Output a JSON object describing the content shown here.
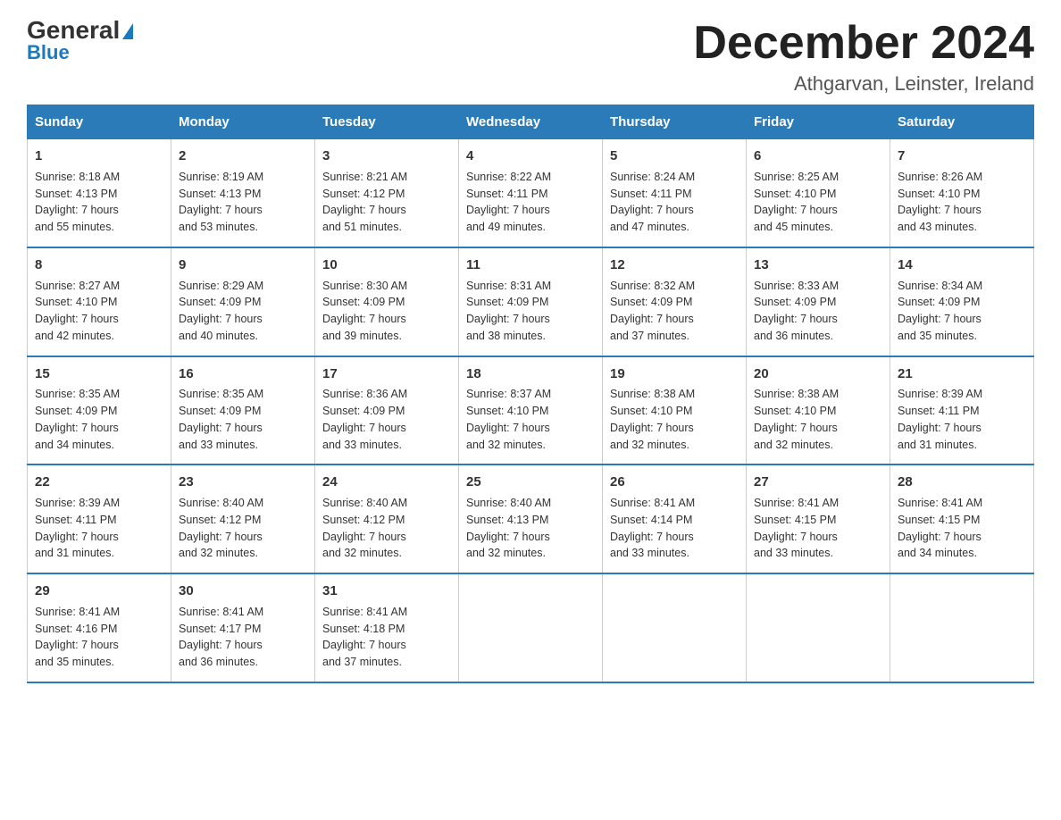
{
  "logo": {
    "general": "General",
    "blue": "Blue",
    "triangle": "▶"
  },
  "header": {
    "month_year": "December 2024",
    "location": "Athgarvan, Leinster, Ireland"
  },
  "columns": [
    "Sunday",
    "Monday",
    "Tuesday",
    "Wednesday",
    "Thursday",
    "Friday",
    "Saturday"
  ],
  "weeks": [
    [
      {
        "day": "1",
        "sunrise": "8:18 AM",
        "sunset": "4:13 PM",
        "daylight": "7 hours and 55 minutes."
      },
      {
        "day": "2",
        "sunrise": "8:19 AM",
        "sunset": "4:13 PM",
        "daylight": "7 hours and 53 minutes."
      },
      {
        "day": "3",
        "sunrise": "8:21 AM",
        "sunset": "4:12 PM",
        "daylight": "7 hours and 51 minutes."
      },
      {
        "day": "4",
        "sunrise": "8:22 AM",
        "sunset": "4:11 PM",
        "daylight": "7 hours and 49 minutes."
      },
      {
        "day": "5",
        "sunrise": "8:24 AM",
        "sunset": "4:11 PM",
        "daylight": "7 hours and 47 minutes."
      },
      {
        "day": "6",
        "sunrise": "8:25 AM",
        "sunset": "4:10 PM",
        "daylight": "7 hours and 45 minutes."
      },
      {
        "day": "7",
        "sunrise": "8:26 AM",
        "sunset": "4:10 PM",
        "daylight": "7 hours and 43 minutes."
      }
    ],
    [
      {
        "day": "8",
        "sunrise": "8:27 AM",
        "sunset": "4:10 PM",
        "daylight": "7 hours and 42 minutes."
      },
      {
        "day": "9",
        "sunrise": "8:29 AM",
        "sunset": "4:09 PM",
        "daylight": "7 hours and 40 minutes."
      },
      {
        "day": "10",
        "sunrise": "8:30 AM",
        "sunset": "4:09 PM",
        "daylight": "7 hours and 39 minutes."
      },
      {
        "day": "11",
        "sunrise": "8:31 AM",
        "sunset": "4:09 PM",
        "daylight": "7 hours and 38 minutes."
      },
      {
        "day": "12",
        "sunrise": "8:32 AM",
        "sunset": "4:09 PM",
        "daylight": "7 hours and 37 minutes."
      },
      {
        "day": "13",
        "sunrise": "8:33 AM",
        "sunset": "4:09 PM",
        "daylight": "7 hours and 36 minutes."
      },
      {
        "day": "14",
        "sunrise": "8:34 AM",
        "sunset": "4:09 PM",
        "daylight": "7 hours and 35 minutes."
      }
    ],
    [
      {
        "day": "15",
        "sunrise": "8:35 AM",
        "sunset": "4:09 PM",
        "daylight": "7 hours and 34 minutes."
      },
      {
        "day": "16",
        "sunrise": "8:35 AM",
        "sunset": "4:09 PM",
        "daylight": "7 hours and 33 minutes."
      },
      {
        "day": "17",
        "sunrise": "8:36 AM",
        "sunset": "4:09 PM",
        "daylight": "7 hours and 33 minutes."
      },
      {
        "day": "18",
        "sunrise": "8:37 AM",
        "sunset": "4:10 PM",
        "daylight": "7 hours and 32 minutes."
      },
      {
        "day": "19",
        "sunrise": "8:38 AM",
        "sunset": "4:10 PM",
        "daylight": "7 hours and 32 minutes."
      },
      {
        "day": "20",
        "sunrise": "8:38 AM",
        "sunset": "4:10 PM",
        "daylight": "7 hours and 32 minutes."
      },
      {
        "day": "21",
        "sunrise": "8:39 AM",
        "sunset": "4:11 PM",
        "daylight": "7 hours and 31 minutes."
      }
    ],
    [
      {
        "day": "22",
        "sunrise": "8:39 AM",
        "sunset": "4:11 PM",
        "daylight": "7 hours and 31 minutes."
      },
      {
        "day": "23",
        "sunrise": "8:40 AM",
        "sunset": "4:12 PM",
        "daylight": "7 hours and 32 minutes."
      },
      {
        "day": "24",
        "sunrise": "8:40 AM",
        "sunset": "4:12 PM",
        "daylight": "7 hours and 32 minutes."
      },
      {
        "day": "25",
        "sunrise": "8:40 AM",
        "sunset": "4:13 PM",
        "daylight": "7 hours and 32 minutes."
      },
      {
        "day": "26",
        "sunrise": "8:41 AM",
        "sunset": "4:14 PM",
        "daylight": "7 hours and 33 minutes."
      },
      {
        "day": "27",
        "sunrise": "8:41 AM",
        "sunset": "4:15 PM",
        "daylight": "7 hours and 33 minutes."
      },
      {
        "day": "28",
        "sunrise": "8:41 AM",
        "sunset": "4:15 PM",
        "daylight": "7 hours and 34 minutes."
      }
    ],
    [
      {
        "day": "29",
        "sunrise": "8:41 AM",
        "sunset": "4:16 PM",
        "daylight": "7 hours and 35 minutes."
      },
      {
        "day": "30",
        "sunrise": "8:41 AM",
        "sunset": "4:17 PM",
        "daylight": "7 hours and 36 minutes."
      },
      {
        "day": "31",
        "sunrise": "8:41 AM",
        "sunset": "4:18 PM",
        "daylight": "7 hours and 37 minutes."
      },
      null,
      null,
      null,
      null
    ]
  ],
  "labels": {
    "sunrise": "Sunrise:",
    "sunset": "Sunset:",
    "daylight": "Daylight:"
  }
}
